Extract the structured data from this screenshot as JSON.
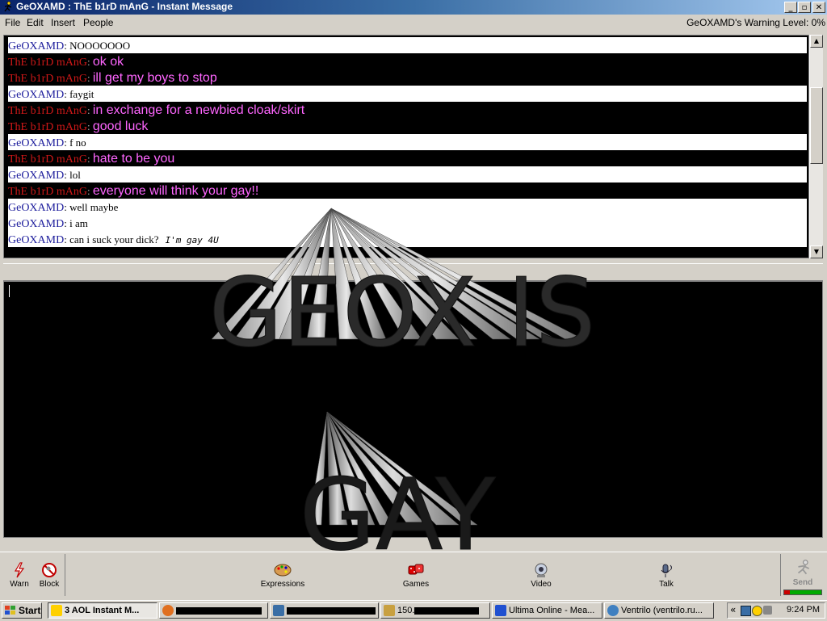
{
  "window": {
    "title": "GeOXAMD : ThE b1rD mAnG - Instant Message",
    "minimize": "_",
    "maximize": "▫",
    "close": "✕"
  },
  "menu": [
    "File",
    "Edit",
    "Insert",
    "People"
  ],
  "warning_level": "GeOXAMD's Warning Level: 0%",
  "conversation": [
    {
      "sender": "GeOXAMD",
      "kind": "geo",
      "text": "NOOOOOOO"
    },
    {
      "sender": "ThE b1rD mAnG",
      "kind": "bird",
      "text": "ok ok"
    },
    {
      "sender": "ThE b1rD mAnG",
      "kind": "bird",
      "text": "ill get my boys to stop"
    },
    {
      "sender": "GeOXAMD",
      "kind": "geo",
      "text": "faygit"
    },
    {
      "sender": "ThE b1rD mAnG",
      "kind": "bird",
      "text": "in exchange for a newbied cloak/skirt"
    },
    {
      "sender": "ThE b1rD mAnG",
      "kind": "bird",
      "text": "good luck"
    },
    {
      "sender": "GeOXAMD",
      "kind": "geo",
      "text": "f no"
    },
    {
      "sender": "ThE b1rD mAnG",
      "kind": "bird",
      "text": "hate to be you"
    },
    {
      "sender": "GeOXAMD",
      "kind": "geo",
      "text": "lol"
    },
    {
      "sender": "ThE b1rD mAnG",
      "kind": "bird",
      "text": "everyone will think your gay!!"
    },
    {
      "sender": "GeOXAMD",
      "kind": "geo",
      "text": "well maybe"
    },
    {
      "sender": "GeOXAMD",
      "kind": "geo",
      "text": "i am"
    },
    {
      "sender": "GeOXAMD",
      "kind": "geo",
      "text": "can i suck your dick?"
    }
  ],
  "handwritten_note": "I'm gay 4U",
  "overlay_text": {
    "line1": "GEOX IS",
    "line2": "GAY"
  },
  "toolbar": {
    "warn": "Warn",
    "block": "Block",
    "expressions": "Expressions",
    "games": "Games",
    "video": "Video",
    "talk": "Talk",
    "send": "Send"
  },
  "taskbar": {
    "start": "Start",
    "tasks": [
      {
        "label": "3 AOL Instant M...",
        "active": true,
        "icon": "aim-running-man-icon"
      },
      {
        "label": "",
        "active": false,
        "icon": "firefox-icon"
      },
      {
        "label": "",
        "active": false,
        "icon": "app-icon"
      },
      {
        "label": "150.",
        "active": false,
        "icon": "pencil-icon"
      },
      {
        "label": "Ultima Online - Mea...",
        "active": false,
        "icon": "window-icon"
      },
      {
        "label": "Ventrilo (ventrilo.ru...",
        "active": false,
        "icon": "ventrilo-icon"
      }
    ],
    "clock": "9:24 PM",
    "tray_chevron": "«"
  },
  "colors": {
    "geo_name": "#1c1c9c",
    "bird_name": "#d01818",
    "bird_text": "#ff66ff",
    "titlebar": "#0a246a"
  }
}
